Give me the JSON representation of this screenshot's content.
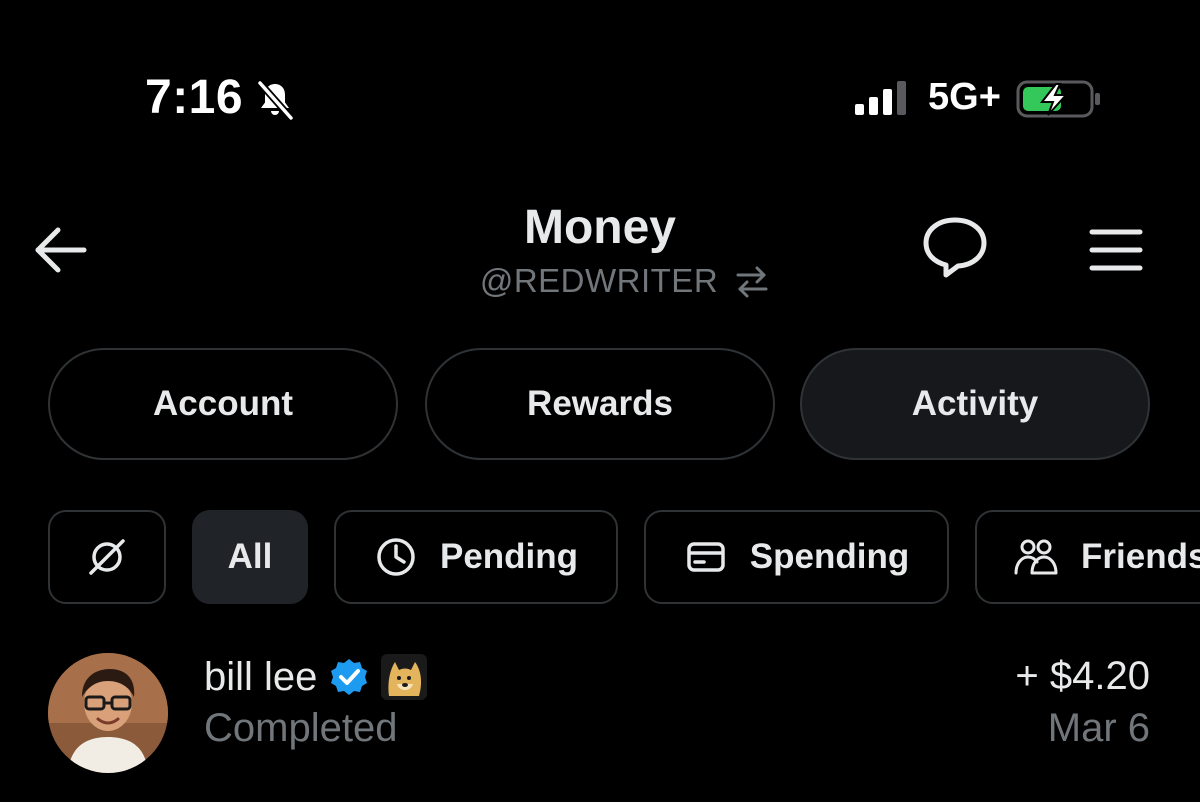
{
  "status_bar": {
    "time": "7:16",
    "network": "5G+",
    "icons": [
      "bell-slash-icon",
      "signal-icon",
      "battery-charging-icon"
    ]
  },
  "header": {
    "title": "Money",
    "handle": "@REDWRITER",
    "icons": [
      "back-arrow-icon",
      "swap-arrows-icon",
      "chat-bubble-icon",
      "menu-icon"
    ]
  },
  "tabs": [
    {
      "label": "Account",
      "active": false
    },
    {
      "label": "Rewards",
      "active": false
    },
    {
      "label": "Activity",
      "active": true
    }
  ],
  "filters": [
    {
      "label": "",
      "icon": "slash-circle-icon",
      "active": false
    },
    {
      "label": "All",
      "icon": "",
      "active": true
    },
    {
      "label": "Pending",
      "icon": "clock-icon",
      "active": false
    },
    {
      "label": "Spending",
      "icon": "card-icon",
      "active": false
    },
    {
      "label": "Friends",
      "icon": "people-icon",
      "active": false
    }
  ],
  "activity": [
    {
      "name": "bill lee",
      "verified": true,
      "emoji_badge": "doge-icon",
      "status": "Completed",
      "amount": "+ $4.20",
      "date": "Mar 6"
    }
  ],
  "colors": {
    "background": "#000000",
    "text_primary": "#e7e9ea",
    "text_secondary": "#71767b",
    "border": "#2f3336",
    "verified_blue": "#1d9bf0",
    "battery_green": "#34c759"
  }
}
